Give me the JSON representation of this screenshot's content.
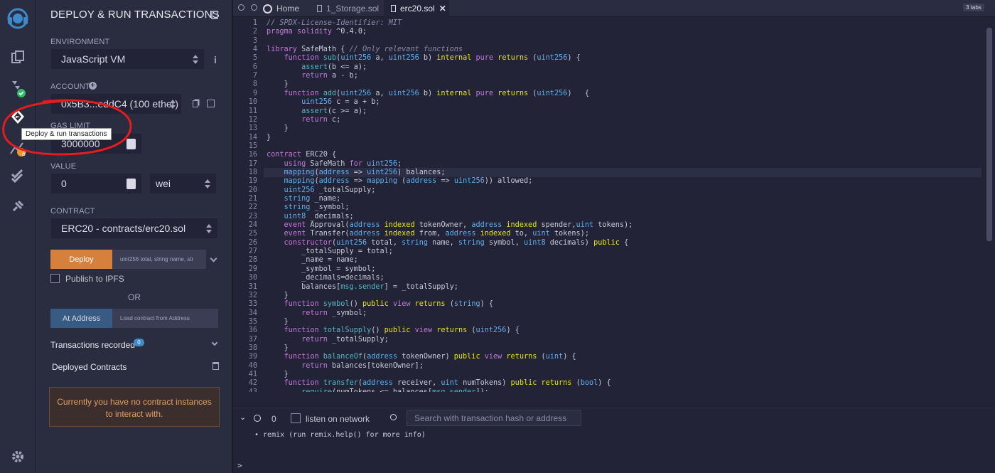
{
  "rail": {
    "tooltip": "Deploy & run transactions",
    "analysis_badge": "8"
  },
  "panel": {
    "title": "DEPLOY & RUN TRANSACTIONS",
    "environment_label": "ENVIRONMENT",
    "environment_value": "JavaScript VM",
    "account_label": "ACCOUNT",
    "account_value": "0x5B3...eddC4 (100 ether)",
    "gas_limit_label": "GAS LIMIT",
    "gas_limit_value": "3000000",
    "value_label": "VALUE",
    "value_amount": "0",
    "value_unit": "wei",
    "contract_label": "CONTRACT",
    "contract_value": "ERC20 - contracts/erc20.sol",
    "deploy_button": "Deploy",
    "deploy_params_placeholder": "uint256 total, string name, str",
    "publish_ipfs": "Publish to IPFS",
    "or_text": "OR",
    "at_address_button": "At Address",
    "at_address_placeholder": "Load contract from Address",
    "transactions_recorded": "Transactions recorded",
    "transactions_count": "0",
    "deployed_contracts": "Deployed Contracts",
    "no_instances_line1": "Currently you have no contract instances",
    "no_instances_line2": "to interact with."
  },
  "editor": {
    "tabs": [
      {
        "label": "Home"
      },
      {
        "label": "1_Storage.sol"
      },
      {
        "label": "erc20.sol"
      }
    ],
    "tabs_count": "3 tabs",
    "active_line": 18
  },
  "terminal": {
    "pending_count": "0",
    "listen_label": "listen on network",
    "search_placeholder": "Search with transaction hash or address",
    "log_line1": "• remix (run remix.help() for more info)",
    "prompt": ">"
  },
  "code_lines": [
    "<span class='cm'>// SPDX-License-Identifier: MIT</span>",
    "<span class='k'>pragma solidity</span> ^0.4.0;",
    "",
    "<span class='k'>library</span> SafeMath { <span class='cm'>// Only relevant functions</span>",
    "    <span class='k'>function</span> <span class='fn'>sub</span>(<span class='t'>uint256</span> a, <span class='t'>uint256</span> b) <span class='y'>internal</span> <span class='k'>pure</span> <span class='y'>returns</span> (<span class='t'>uint256</span>) {",
    "        <span class='f'>assert</span>(b &lt;= a);",
    "        <span class='k'>return</span> a - b;",
    "    }",
    "    <span class='k'>function</span> <span class='fn'>add</span>(<span class='t'>uint256</span> a, <span class='t'>uint256</span> b) <span class='y'>internal</span> <span class='k'>pure</span> <span class='y'>returns</span> (<span class='t'>uint256</span>)   {",
    "        <span class='t'>uint256</span> c = a + b;",
    "        <span class='f'>assert</span>(c &gt;= a);",
    "        <span class='k'>return</span> c;",
    "    }",
    "}",
    "",
    "<span class='k'>contract</span> ERC20 {",
    "    <span class='k'>using</span> SafeMath <span class='k'>for</span> <span class='t'>uint256</span>;",
    "    <span class='t'>mapping</span>(<span class='t'>address</span> =&gt; <span class='t'>uint256</span>) balances;",
    "    <span class='t'>mapping</span>(<span class='t'>address</span> =&gt; <span class='t'>mapping</span> (<span class='t'>address</span> =&gt; <span class='t'>uint256</span>)) allowed;",
    "    <span class='t'>uint256</span> _totalSupply;",
    "    <span class='t'>string</span> _name;",
    "    <span class='t'>string</span> _symbol;",
    "    <span class='t'>uint8</span> _decimals;",
    "    <span class='k'>event</span> Approval(<span class='t'>address</span> <span class='y'>indexed</span> tokenOwner, <span class='t'>address</span> <span class='y'>indexed</span> spender,<span class='t'>uint</span> tokens);",
    "    <span class='k'>event</span> Transfer(<span class='t'>address</span> <span class='y'>indexed</span> from, <span class='t'>address</span> <span class='y'>indexed</span> to, <span class='t'>uint</span> tokens);",
    "    <span class='k'>constructor</span>(<span class='t'>uint256</span> total, <span class='t'>string</span> name, <span class='t'>string</span> symbol, <span class='t'>uint8</span> decimals) <span class='y'>public</span> {",
    "        _totalSupply = total;",
    "        _name = name;",
    "        _symbol = symbol;",
    "        _decimals=decimals;",
    "        balances[<span class='f'>msg.sender</span>] = _totalSupply;",
    "    }",
    "    <span class='k'>function</span> <span class='fn'>symbol</span>() <span class='y'>public</span> <span class='k'>view</span> <span class='y'>returns</span> (<span class='t'>string</span>) {",
    "        <span class='k'>return</span> _symbol;",
    "    }",
    "    <span class='k'>function</span> <span class='fn'>totalSupply</span>() <span class='y'>public</span> <span class='k'>view</span> <span class='y'>returns</span> (<span class='t'>uint256</span>) {",
    "        <span class='k'>return</span> _totalSupply;",
    "    }",
    "    <span class='k'>function</span> <span class='fn'>balanceOf</span>(<span class='t'>address</span> tokenOwner) <span class='y'>public</span> <span class='k'>view</span> <span class='y'>returns</span> (<span class='t'>uint</span>) {",
    "        <span class='k'>return</span> balances[tokenOwner];",
    "    }",
    "    <span class='k'>function</span> <span class='fn'>transfer</span>(<span class='t'>address</span> receiver, <span class='t'>uint</span> numTokens) <span class='y'>public</span> <span class='y'>returns</span> (<span class='t'>bool</span>) {",
    "        <span class='f'>require</span>(numTokens &lt;= balances[<span class='f'>msg.sender</span>]);"
  ]
}
